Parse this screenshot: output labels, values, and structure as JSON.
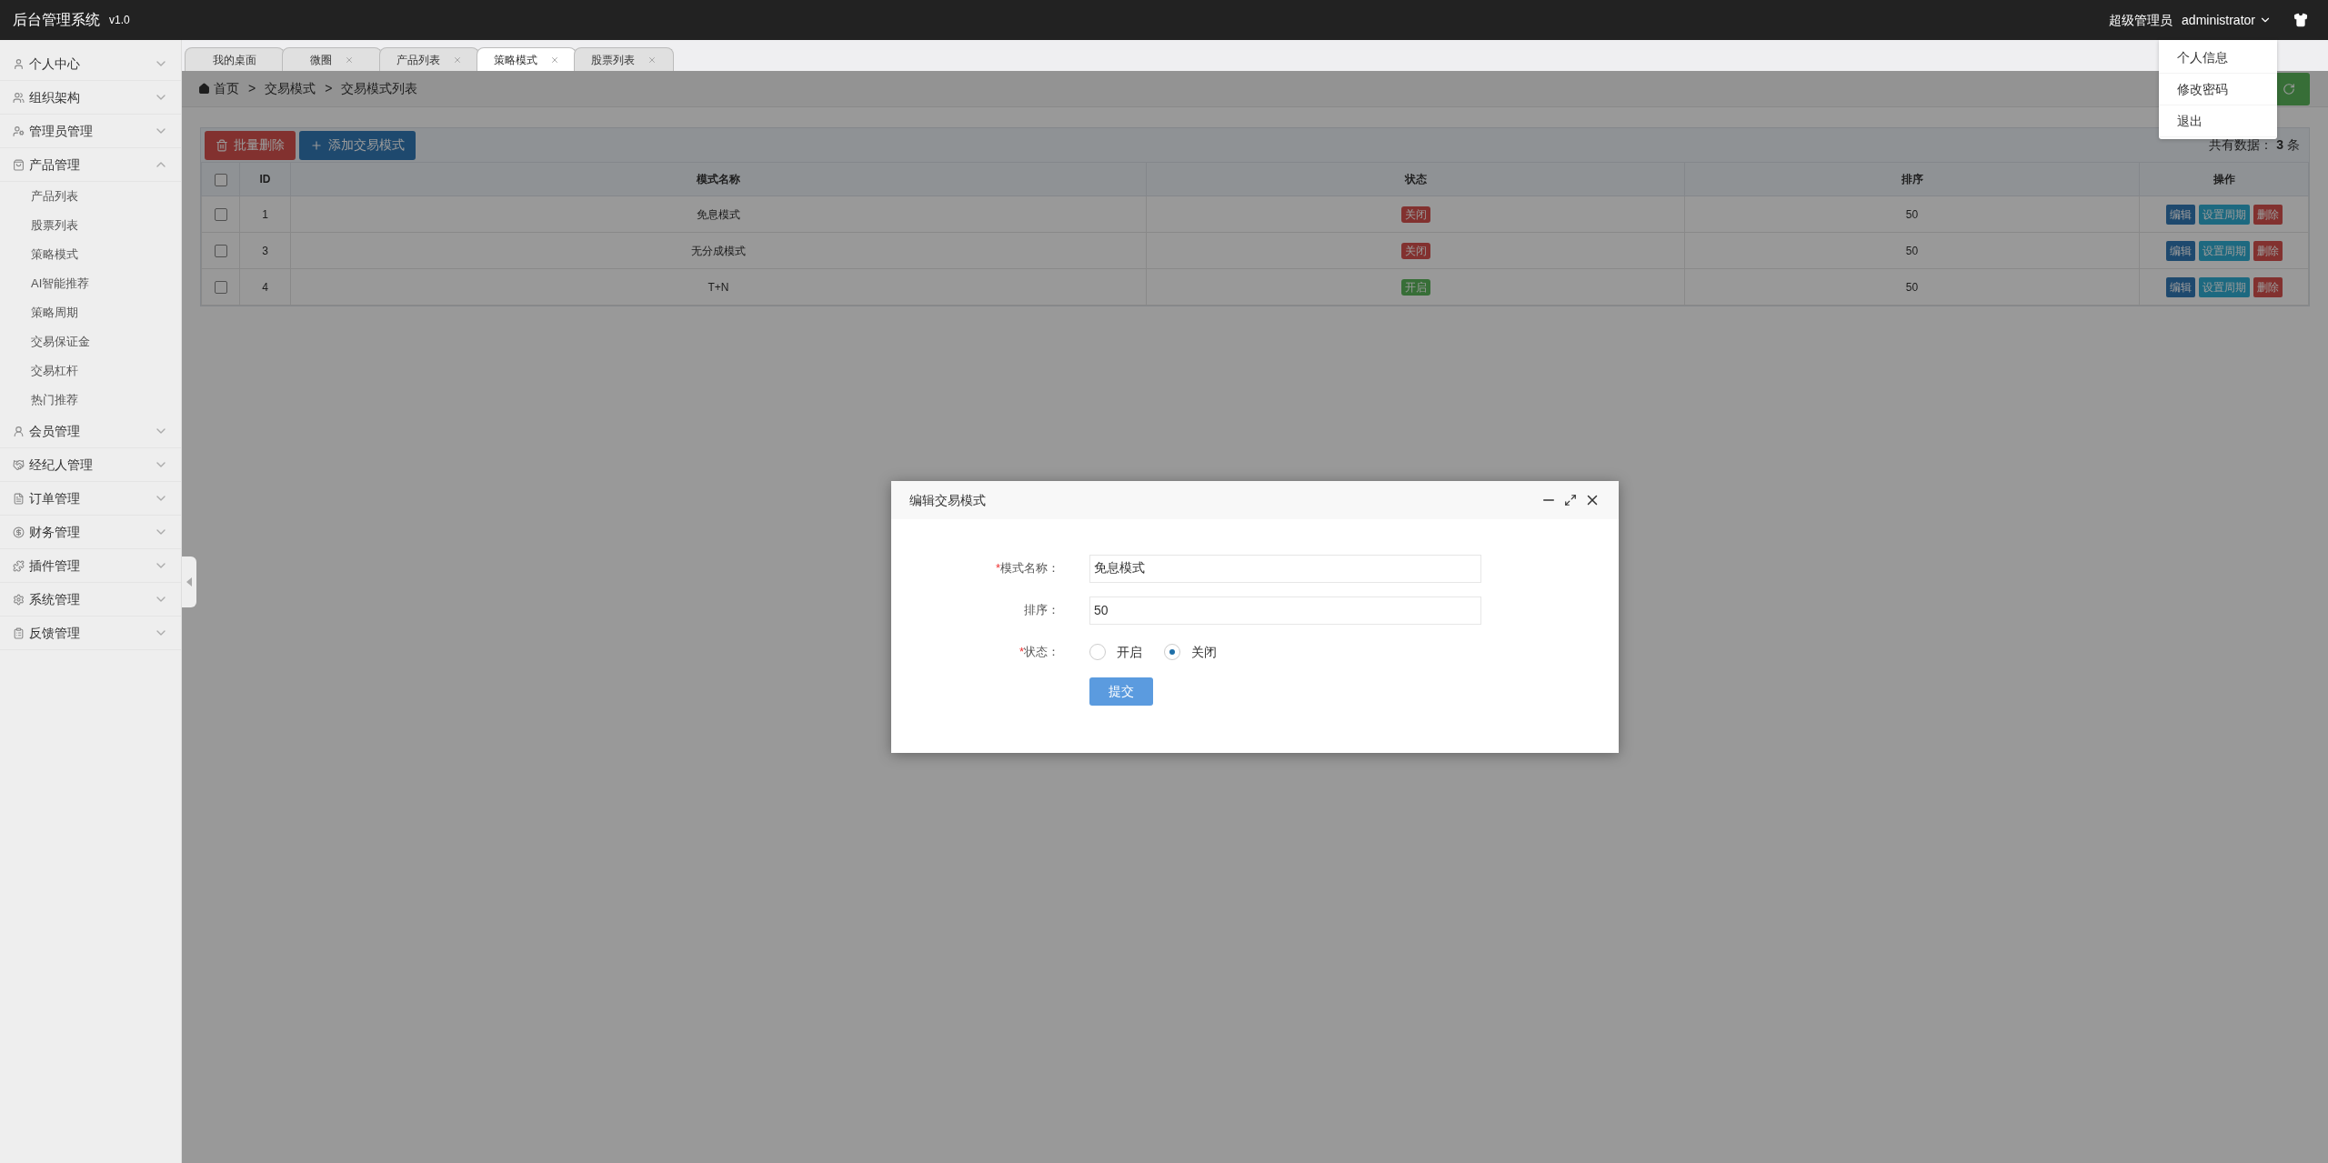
{
  "header": {
    "title": "后台管理系统",
    "version": "v1.0",
    "role": "超级管理员",
    "user": "administrator"
  },
  "user_menu": [
    "个人信息",
    "修改密码",
    "退出"
  ],
  "sidebar": {
    "items": [
      {
        "label": "个人中心",
        "expanded": false
      },
      {
        "label": "组织架构",
        "expanded": false
      },
      {
        "label": "管理员管理",
        "expanded": false
      },
      {
        "label": "产品管理",
        "expanded": true,
        "children": [
          "产品列表",
          "股票列表",
          "策略模式",
          "AI智能推荐",
          "策略周期",
          "交易保证金",
          "交易杠杆",
          "热门推荐"
        ]
      },
      {
        "label": "会员管理",
        "expanded": false
      },
      {
        "label": "经纪人管理",
        "expanded": false
      },
      {
        "label": "订单管理",
        "expanded": false
      },
      {
        "label": "财务管理",
        "expanded": false
      },
      {
        "label": "插件管理",
        "expanded": false
      },
      {
        "label": "系统管理",
        "expanded": false
      },
      {
        "label": "反馈管理",
        "expanded": false
      }
    ]
  },
  "tabs": [
    {
      "label": "我的桌面",
      "selected": false,
      "closable": false
    },
    {
      "label": "微圈",
      "selected": false,
      "closable": true
    },
    {
      "label": "产品列表",
      "selected": false,
      "closable": true
    },
    {
      "label": "策略模式",
      "selected": true,
      "closable": true
    },
    {
      "label": "股票列表",
      "selected": false,
      "closable": true
    }
  ],
  "breadcrumb": [
    {
      "label": "首页"
    },
    {
      "separator": ">",
      "label": "交易模式"
    },
    {
      "separator": ">",
      "label": "交易模式列表"
    }
  ],
  "toolbar": {
    "buttons": [
      {
        "label": "批量删除",
        "kind": "danger"
      },
      {
        "label": "添加交易模式",
        "kind": "primary"
      }
    ],
    "total_label": "共有数据：",
    "total": "3",
    "total_unit": "条"
  },
  "table": {
    "all_checked": false,
    "columns": [
      "ID",
      "模式名称",
      "状态",
      "排序",
      "操作"
    ],
    "rows": [
      {
        "checked": false,
        "id": "1",
        "name": "免息模式",
        "status": "关闭",
        "status_on": false,
        "sort": "50",
        "actions": [
          "编辑",
          "设置周期",
          "删除"
        ]
      },
      {
        "checked": false,
        "id": "3",
        "name": "无分成模式",
        "status": "关闭",
        "status_on": false,
        "sort": "50",
        "actions": [
          "编辑",
          "设置周期",
          "删除"
        ]
      },
      {
        "checked": false,
        "id": "4",
        "name": "T+N",
        "status": "开启",
        "status_on": true,
        "sort": "50",
        "actions": [
          "编辑",
          "设置周期",
          "删除"
        ]
      }
    ]
  },
  "dialog": {
    "title": "编辑交易模式",
    "fields": [
      {
        "kind": "text",
        "label": "模式名称：",
        "required_mark": "*",
        "value": "免息模式"
      },
      {
        "kind": "text",
        "label": "排序：",
        "value": "50"
      },
      {
        "kind": "radio",
        "label": "状态：",
        "required_mark": "*",
        "options": [
          {
            "label": "开启",
            "selected": false
          },
          {
            "label": "关闭",
            "selected": true
          }
        ]
      }
    ],
    "submit": "提交"
  }
}
